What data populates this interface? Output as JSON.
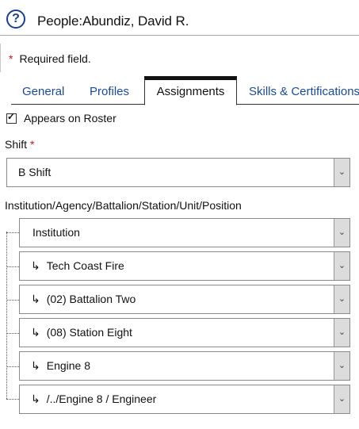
{
  "header": {
    "title_prefix": "People:",
    "title_name": "Abundiz, David R."
  },
  "required_note": "Required field.",
  "tabs": [
    {
      "label": "General"
    },
    {
      "label": "Profiles"
    },
    {
      "label": "Assignments"
    },
    {
      "label": "Skills & Certifications"
    }
  ],
  "roster": {
    "label": "Appears on Roster",
    "checked": true
  },
  "shift": {
    "label": "Shift",
    "value": "B Shift"
  },
  "path": {
    "label": "Institution/Agency/Battalion/Station/Unit/Position",
    "levels": [
      {
        "value": "Institution"
      },
      {
        "value": "Tech Coast Fire"
      },
      {
        "value": "(02) Battalion Two"
      },
      {
        "value": "(08) Station Eight"
      },
      {
        "value": "Engine 8"
      },
      {
        "value": "/../Engine 8 / Engineer"
      }
    ]
  },
  "colors": {
    "link": "#1a4a9c",
    "required": "#c21818"
  }
}
